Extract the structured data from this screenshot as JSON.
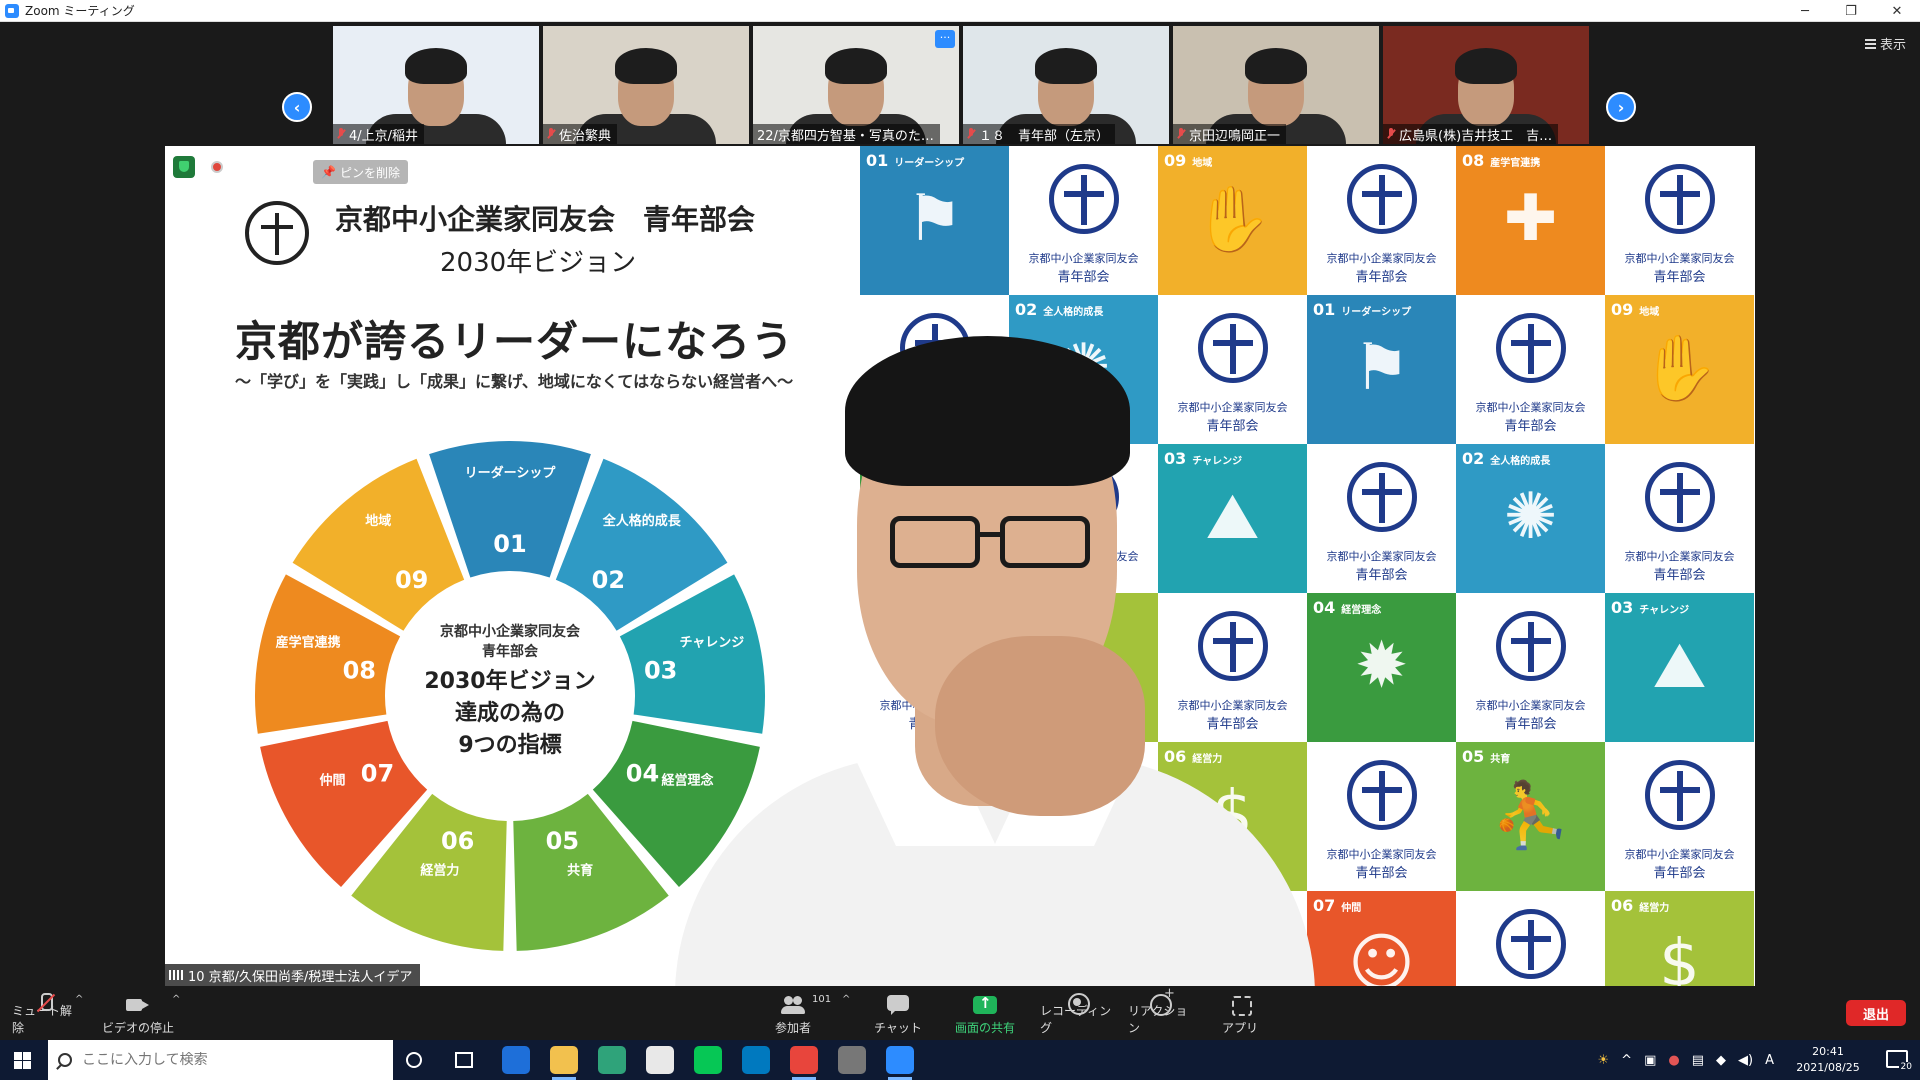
{
  "window": {
    "title": "Zoom ミーティング",
    "controls": [
      "─",
      "❐",
      "✕"
    ]
  },
  "view_button": "表示",
  "pin_badge": "ピンを削除",
  "participants": [
    {
      "name": "4/上京/稲井",
      "muted": true,
      "bg": "#e8eef5"
    },
    {
      "name": "佐治繁典",
      "muted": true,
      "bg": "#d9d3c8"
    },
    {
      "name": "22/京都四方智基・写真のた…",
      "muted": false,
      "bg": "#e6e6e2"
    },
    {
      "name": "１８　青年部（左京）",
      "muted": true,
      "bg": "#dfe6ea"
    },
    {
      "name": "京田辺鳴岡正一",
      "muted": true,
      "bg": "#c9c0b0"
    },
    {
      "name": "広島県(株)吉井技工　吉…",
      "muted": true,
      "bg": "#7a2a20"
    }
  ],
  "slide": {
    "org": "京都中小企業家同友会　青年部会",
    "vision": "2030年ビジョン",
    "heading": "京都が誇るリーダーになろう",
    "subheading": "〜「学び」を「実践」し「成果」に繋げ、地域になくてはならない経営者へ〜",
    "center": [
      "京都中小企業家同友会",
      "青年部会",
      "2030年ビジョン",
      "達成の為の",
      "9つの指標"
    ],
    "segments": [
      {
        "num": "01",
        "label": "リーダーシップ",
        "color": "#2a86b8"
      },
      {
        "num": "02",
        "label": "全人格的成長",
        "color": "#2f9ac5"
      },
      {
        "num": "03",
        "label": "チャレンジ",
        "color": "#22a3b0"
      },
      {
        "num": "04",
        "label": "経営理念",
        "color": "#3a9b3f"
      },
      {
        "num": "05",
        "label": "共育",
        "color": "#6db33f"
      },
      {
        "num": "06",
        "label": "経営力",
        "color": "#a4c23a"
      },
      {
        "num": "07",
        "label": "仲間",
        "color": "#e8562a"
      },
      {
        "num": "08",
        "label": "産学官連携",
        "color": "#ee8a1f"
      },
      {
        "num": "09",
        "label": "地域",
        "color": "#f2b02a"
      }
    ]
  },
  "grid": {
    "org1": "京都中小企業家同友会",
    "org2": "青年部会",
    "cells": [
      {
        "type": "ind",
        "num": "01",
        "label": "リーダーシップ",
        "color": "#2a86b8",
        "glyph": "⚑"
      },
      {
        "type": "logo"
      },
      {
        "type": "ind",
        "num": "09",
        "label": "地域",
        "color": "#f2b02a",
        "glyph": "✋"
      },
      {
        "type": "logo"
      },
      {
        "type": "ind",
        "num": "08",
        "label": "産学官連携",
        "color": "#ee8a1f",
        "glyph": "✚"
      },
      {
        "type": "logo"
      },
      {
        "type": "logo"
      },
      {
        "type": "ind",
        "num": "02",
        "label": "全人格的成長",
        "color": "#2f9ac5",
        "glyph": "✺"
      },
      {
        "type": "logo"
      },
      {
        "type": "ind",
        "num": "01",
        "label": "リーダーシップ",
        "color": "#2a86b8",
        "glyph": "⚑"
      },
      {
        "type": "logo"
      },
      {
        "type": "ind",
        "num": "09",
        "label": "地域",
        "color": "#f2b02a",
        "glyph": "✋"
      },
      {
        "type": "ind",
        "num": "04",
        "label": "経営理念",
        "color": "#3a9b3f",
        "glyph": "✹"
      },
      {
        "type": "logo"
      },
      {
        "type": "ind",
        "num": "03",
        "label": "チャレンジ",
        "color": "#22a3b0",
        "glyph": "⛰"
      },
      {
        "type": "logo"
      },
      {
        "type": "ind",
        "num": "02",
        "label": "全人格的成長",
        "color": "#2f9ac5",
        "glyph": "✺"
      },
      {
        "type": "logo"
      },
      {
        "type": "logo"
      },
      {
        "type": "ind",
        "num": "06",
        "label": "経営力",
        "color": "#a4c23a",
        "glyph": "$"
      },
      {
        "type": "logo"
      },
      {
        "type": "ind",
        "num": "04",
        "label": "経営理念",
        "color": "#3a9b3f",
        "glyph": "✹"
      },
      {
        "type": "logo"
      },
      {
        "type": "ind",
        "num": "03",
        "label": "チャレンジ",
        "color": "#22a3b0",
        "glyph": "⛰"
      },
      {
        "type": "logo"
      },
      {
        "type": "logo"
      },
      {
        "type": "ind",
        "num": "06",
        "label": "経営力",
        "color": "#a4c23a",
        "glyph": "$"
      },
      {
        "type": "logo"
      },
      {
        "type": "ind",
        "num": "05",
        "label": "共育",
        "color": "#6db33f",
        "glyph": "⛹"
      },
      {
        "type": "logo"
      },
      {
        "type": "ind",
        "num": "07",
        "label": "仲間",
        "color": "#e8562a",
        "glyph": "☺"
      },
      {
        "type": "logo"
      },
      {
        "type": "logo"
      },
      {
        "type": "ind",
        "num": "07",
        "label": "仲間",
        "color": "#e8562a",
        "glyph": "☺"
      },
      {
        "type": "logo"
      },
      {
        "type": "ind",
        "num": "06",
        "label": "経営力",
        "color": "#a4c23a",
        "glyph": "$"
      }
    ]
  },
  "speaker_caption": "10  京都/久保田尚季/税理士法人イデア",
  "toolbar": {
    "mute": "ミュート解除",
    "video": "ビデオの停止",
    "participants": "参加者",
    "participant_count": "101",
    "chat": "チャット",
    "share": "画面の共有",
    "record": "レコーディング",
    "reaction": "リアクション",
    "apps": "アプリ",
    "leave": "退出"
  },
  "taskbar": {
    "search_placeholder": "ここに入力して検索",
    "apps": [
      {
        "name": "bw-app",
        "color": "#1e6fd9"
      },
      {
        "name": "explorer",
        "color": "#f2c14e"
      },
      {
        "name": "edge",
        "color": "#2fa37a"
      },
      {
        "name": "slack",
        "color": "#e8e8e8"
      },
      {
        "name": "line",
        "color": "#06c755"
      },
      {
        "name": "trello",
        "color": "#0079bf"
      },
      {
        "name": "chrome",
        "color": "#e8453c"
      },
      {
        "name": "settings",
        "color": "#777777"
      },
      {
        "name": "zoom",
        "color": "#2d8cff"
      }
    ],
    "time": "20:41",
    "date": "2021/08/25",
    "ime": "A",
    "notifications": "20"
  }
}
